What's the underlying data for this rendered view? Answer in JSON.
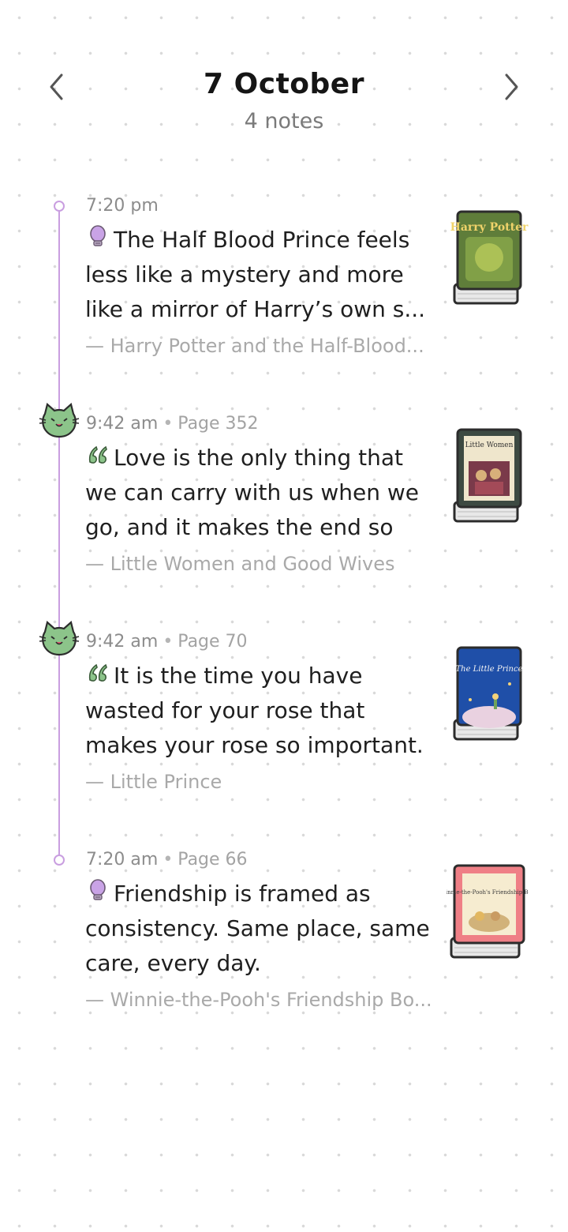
{
  "header": {
    "title": "7 October",
    "subtitle": "4 notes"
  },
  "entries": [
    {
      "time": "7:20 pm",
      "page": "",
      "marker": "ring",
      "icon": "lightbulb-icon",
      "text": "The Half Blood Prince feels less like a mystery and more like a mirror of Harry’s own s...",
      "source": "— Harry Potter and the Half-Blood...",
      "cover_title": "Harry Potter"
    },
    {
      "time": "9:42 am",
      "page": "Page 352",
      "marker": "cat-mood",
      "icon": "quote-icon",
      "text": "Love is the only thing that we can carry with us when we go, and it makes the end so ea...",
      "source": "— Little Women and Good Wives",
      "cover_title": "Little Women"
    },
    {
      "time": "9:42 am",
      "page": "Page 70",
      "marker": "cat-mood",
      "icon": "quote-icon",
      "text": "It is the time you have wasted for your rose that makes your rose so important.",
      "source": "— Little Prince",
      "cover_title": "The Little Prince"
    },
    {
      "time": "7:20 am",
      "page": "Page 66",
      "marker": "ring",
      "icon": "lightbulb-icon",
      "text": "Friendship is framed as consistency. Same place, same care, every day.",
      "source": "— Winnie-the-Pooh's Friendship Bo...",
      "cover_title": "Winnie-the-Pooh's Friendship Book"
    }
  ],
  "colors": {
    "timeline": "#c99ee0",
    "cat": "#8cc48a",
    "bulb": "#c9a3e6"
  }
}
